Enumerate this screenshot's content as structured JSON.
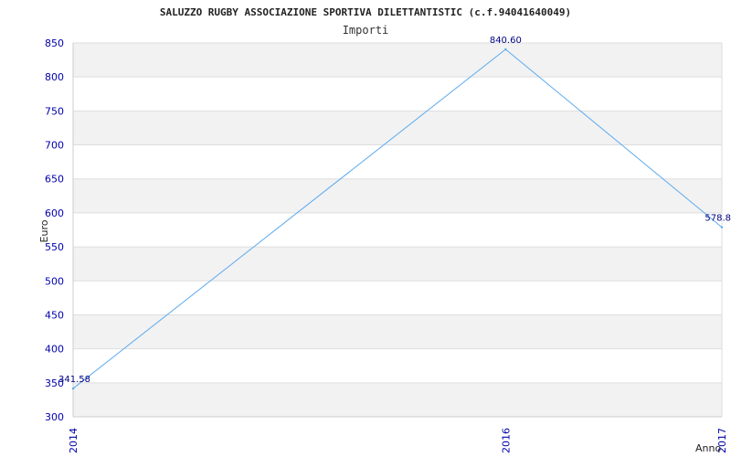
{
  "chart_data": {
    "type": "line",
    "title": "SALUZZO RUGBY ASSOCIAZIONE SPORTIVA DILETTANTISTIC (c.f.94041640049)",
    "subtitle": "Importi",
    "xlabel": "Anno",
    "ylabel": "Euro",
    "categories": [
      "2014",
      "2016",
      "2017"
    ],
    "series": [
      {
        "values": [
          341.58,
          840.6,
          578.8
        ]
      }
    ],
    "value_labels": [
      "341.58",
      "840.60",
      "578.8"
    ],
    "y_ticks": [
      "300",
      "350",
      "400",
      "450",
      "500",
      "550",
      "600",
      "650",
      "700",
      "750",
      "800",
      "850"
    ],
    "ylim": [
      300,
      850
    ],
    "grid": true,
    "colors": {
      "line": "#5aaaf0",
      "band": "#f2f2f2",
      "grid": "#dddddd",
      "ticks": "#0000aa",
      "data_labels": "#000080"
    }
  }
}
